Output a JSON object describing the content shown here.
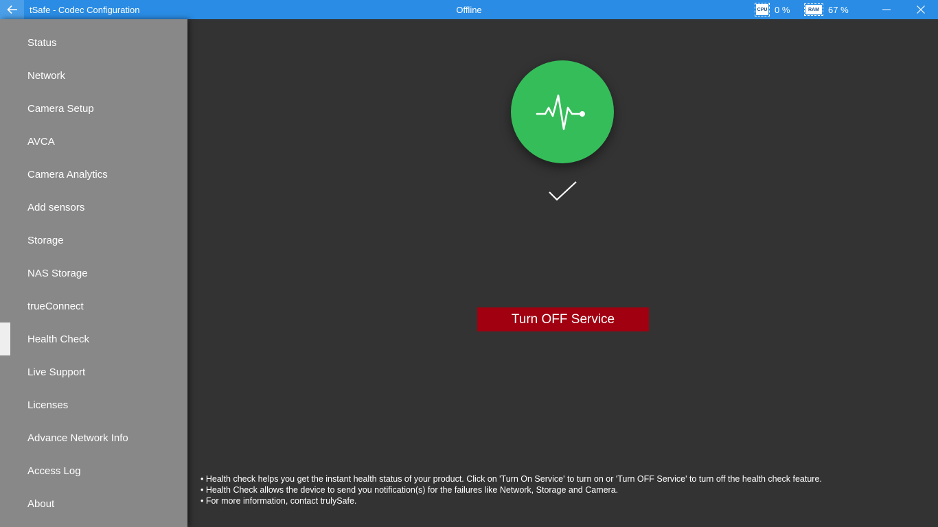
{
  "titlebar": {
    "title": "tSafe - Codec Configuration",
    "status": "Offline",
    "cpu_chip": "CPU",
    "cpu_value": "0 %",
    "ram_chip": "RAM",
    "ram_value": "67 %"
  },
  "sidebar": {
    "active_index": 9,
    "items": [
      {
        "label": "Status"
      },
      {
        "label": "Network"
      },
      {
        "label": "Camera Setup"
      },
      {
        "label": "AVCA"
      },
      {
        "label": "Camera Analytics"
      },
      {
        "label": "Add sensors"
      },
      {
        "label": "Storage"
      },
      {
        "label": "NAS Storage"
      },
      {
        "label": "trueConnect"
      },
      {
        "label": "Health Check"
      },
      {
        "label": "Live Support"
      },
      {
        "label": "Licenses"
      },
      {
        "label": "Advance Network Info"
      },
      {
        "label": "Access Log"
      },
      {
        "label": "About"
      }
    ]
  },
  "main": {
    "status_icon": "heartbeat-icon",
    "status_check": "check-icon",
    "button_label": "Turn OFF Service",
    "notes": [
      "• Health check helps you get the instant health status of your product. Click on 'Turn On Service' to turn on or 'Turn OFF Service' to turn off the health check feature.",
      "• Health Check allows the device to send you notification(s) for the failures like Network, Storage and Camera.",
      "• For more information, contact trulySafe."
    ]
  },
  "colors": {
    "titlebar": "#2a8ce4",
    "sidebar": "#888888",
    "main_bg": "#333333",
    "status_ok": "#35bd5a",
    "button": "#a00010"
  }
}
